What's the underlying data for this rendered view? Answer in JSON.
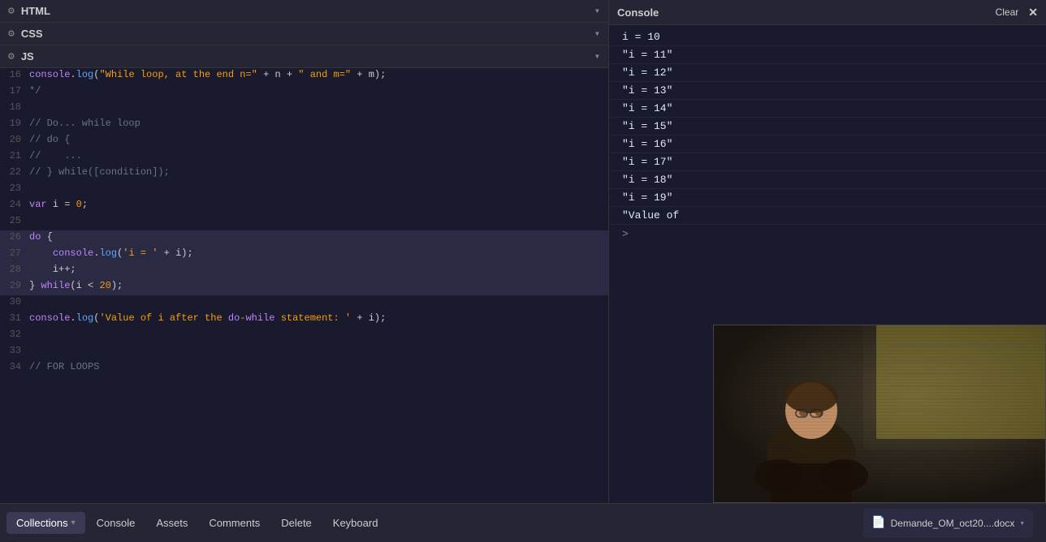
{
  "sections": {
    "html": {
      "title": "HTML",
      "gear": "⚙",
      "chevron": "▾"
    },
    "css": {
      "title": "CSS",
      "gear": "⚙",
      "chevron": "▾"
    },
    "js": {
      "title": "JS",
      "gear": "⚙",
      "chevron": "▾"
    }
  },
  "code_lines": [
    {
      "num": "16",
      "content": "console.log(\"While loop, at the end n=\" + n + \" and m=\" + m);",
      "highlight": false
    },
    {
      "num": "17",
      "content": "*/",
      "highlight": false
    },
    {
      "num": "18",
      "content": "",
      "highlight": false
    },
    {
      "num": "19",
      "content": "// Do... while loop",
      "highlight": false
    },
    {
      "num": "20",
      "content": "// do {",
      "highlight": false
    },
    {
      "num": "21",
      "content": "//    ...",
      "highlight": false
    },
    {
      "num": "22",
      "content": "// } while([condition]);",
      "highlight": false
    },
    {
      "num": "23",
      "content": "",
      "highlight": false
    },
    {
      "num": "24",
      "content": "var i = 0;",
      "highlight": false
    },
    {
      "num": "25",
      "content": "",
      "highlight": false
    },
    {
      "num": "26",
      "content": "do {",
      "highlight": true
    },
    {
      "num": "27",
      "content": "    console.log('i = ' + i);",
      "highlight": true
    },
    {
      "num": "28",
      "content": "    i++;",
      "highlight": true
    },
    {
      "num": "29",
      "content": "} while(i < 20);",
      "highlight": true
    },
    {
      "num": "30",
      "content": "",
      "highlight": false
    },
    {
      "num": "31",
      "content": "console.log('Value of i after the do-while statement: ' + i);",
      "highlight": false
    },
    {
      "num": "32",
      "content": "",
      "highlight": false
    },
    {
      "num": "33",
      "content": "",
      "highlight": false
    },
    {
      "num": "34",
      "content": "// FOR LOOPS",
      "highlight": false
    }
  ],
  "console": {
    "title": "Console",
    "clear_label": "Clear",
    "close_label": "✕",
    "output": [
      "i = 10",
      "\"i = 11\"",
      "\"i = 12\"",
      "\"i = 13\"",
      "\"i = 14\"",
      "\"i = 15\"",
      "\"i = 16\"",
      "\"i = 17\"",
      "\"i = 18\"",
      "\"i = 19\"",
      "\"Value of"
    ],
    "prompt": ">"
  },
  "bottom_tabs": [
    {
      "label": "Collections",
      "arrow": "▾",
      "active": true
    },
    {
      "label": "Console",
      "arrow": null,
      "active": false
    },
    {
      "label": "Assets",
      "arrow": null,
      "active": false
    },
    {
      "label": "Comments",
      "arrow": null,
      "active": false
    },
    {
      "label": "Delete",
      "arrow": null,
      "active": false
    },
    {
      "label": "Keyboard",
      "arrow": null,
      "active": false
    }
  ],
  "file": {
    "name": "Demande_OM_oct20....docx",
    "icon": "📄",
    "arrow": "▾"
  }
}
